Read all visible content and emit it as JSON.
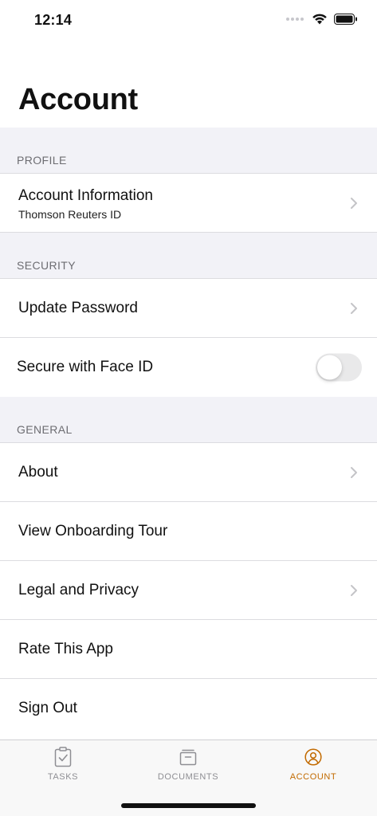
{
  "status_bar": {
    "time": "12:14"
  },
  "page_title": "Account",
  "sections": {
    "profile": {
      "header": "PROFILE",
      "account_info": {
        "title": "Account Information",
        "subtitle": "Thomson Reuters ID"
      }
    },
    "security": {
      "header": "SECURITY",
      "update_password": "Update Password",
      "face_id": {
        "title": "Secure with Face ID",
        "enabled": false
      }
    },
    "general": {
      "header": "GENERAL",
      "about": "About",
      "onboarding": "View Onboarding Tour",
      "legal": "Legal and Privacy",
      "rate": "Rate This App",
      "sign_out": "Sign Out"
    }
  },
  "tab_bar": {
    "tasks": "TASKS",
    "documents": "DOCUMENTS",
    "account": "ACCOUNT",
    "active": "account"
  },
  "colors": {
    "accent": "#c26a00",
    "group_background": "#f2f2f7",
    "secondary_text": "#6d6d72"
  },
  "icons": {
    "tasks": "clipboard-check-icon",
    "documents": "inbox-tray-icon",
    "account": "person-circle-icon",
    "chevron": "chevron-right-icon"
  }
}
